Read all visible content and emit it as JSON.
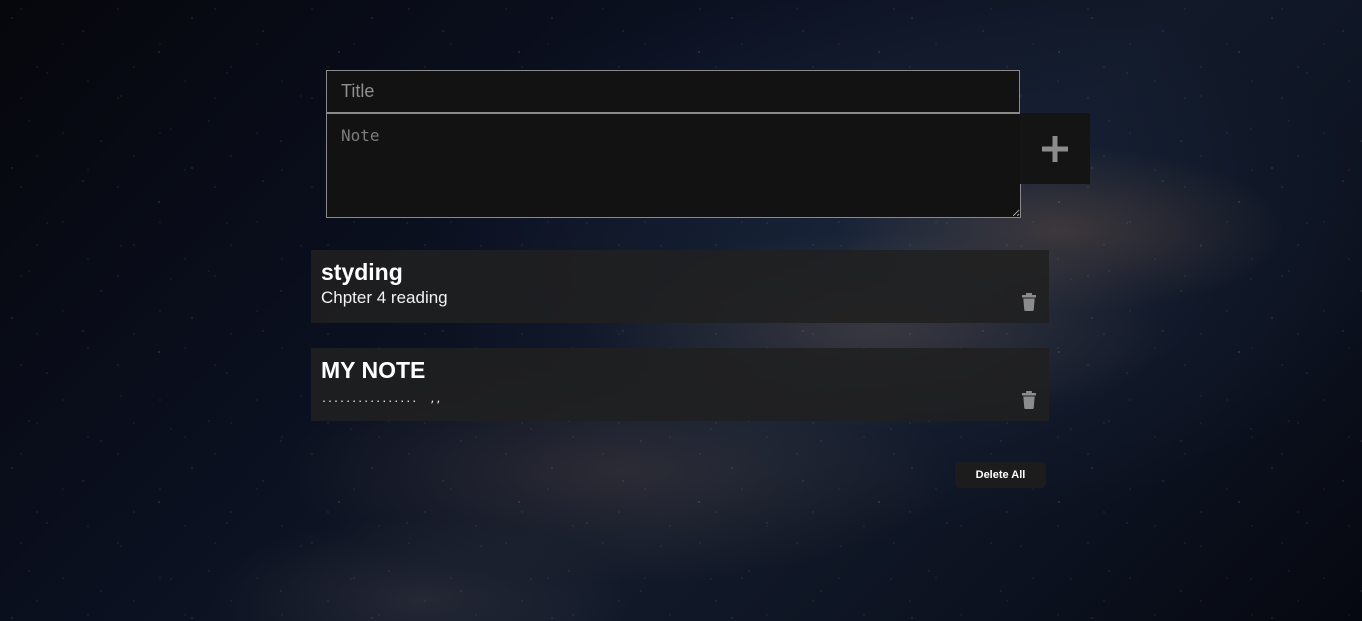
{
  "form": {
    "title_placeholder": "Title",
    "note_placeholder": "Note",
    "add_icon": "plus-icon"
  },
  "notes": [
    {
      "title": "styding",
      "body": "Chpter 4 reading",
      "delete_icon": "trash-icon"
    },
    {
      "title": "MY NOTE",
      "body": "................  ,,",
      "delete_icon": "trash-icon"
    }
  ],
  "actions": {
    "delete_all_label": "Delete All"
  },
  "colors": {
    "input_bg": "#121212",
    "card_bg": "#202020",
    "icon_gray": "#8c8c8c",
    "text": "#ffffff"
  }
}
